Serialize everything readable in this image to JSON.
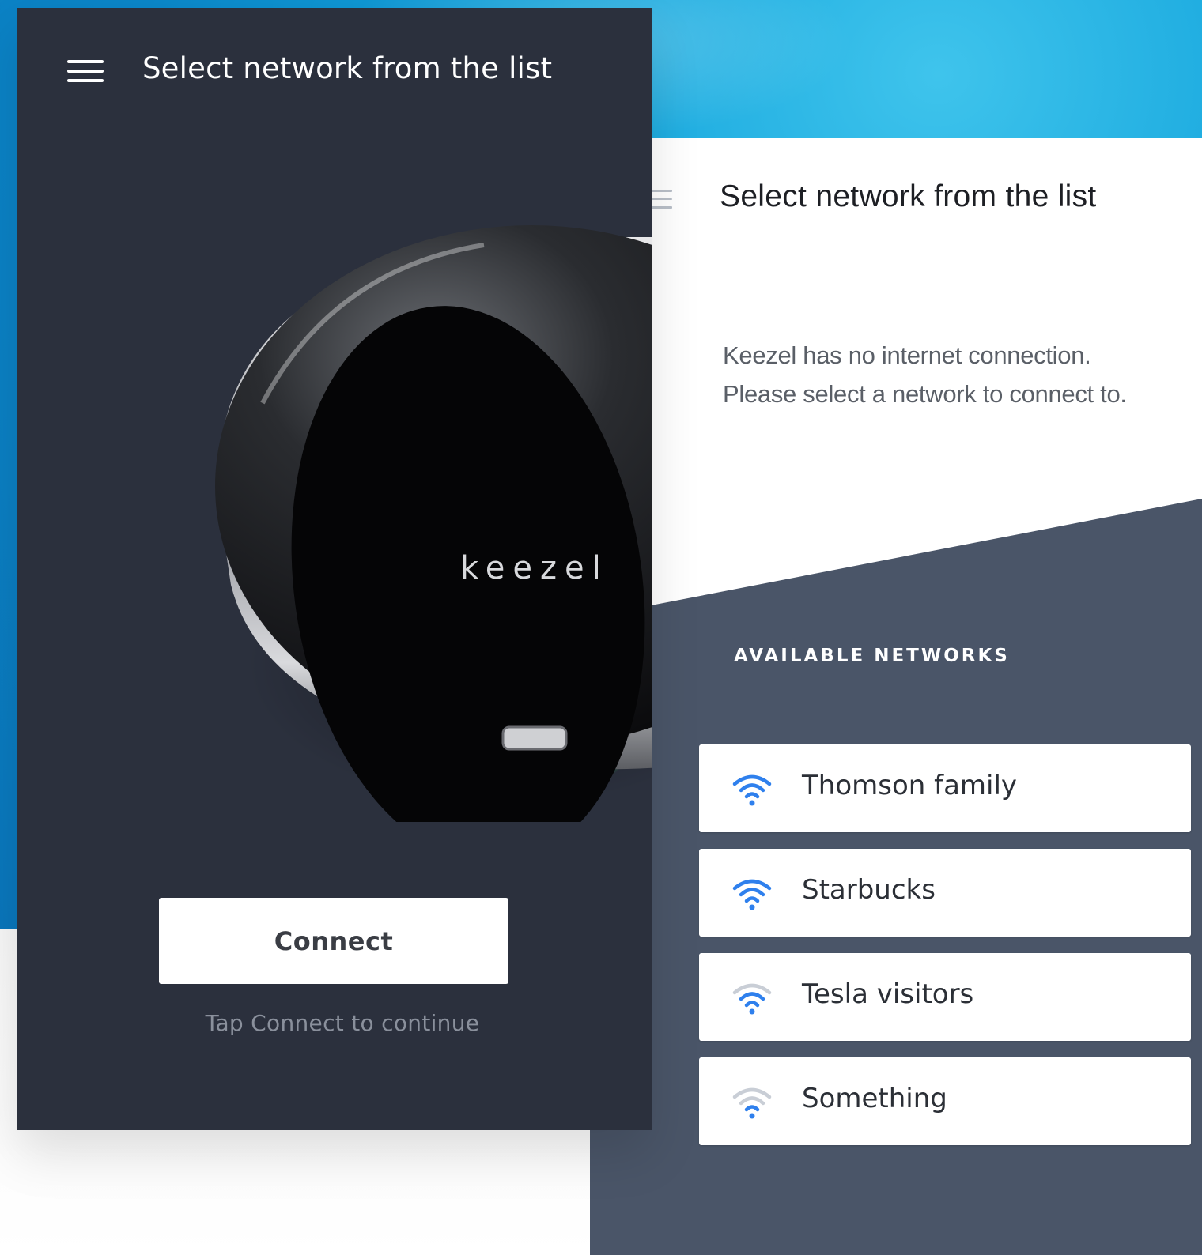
{
  "left_screen": {
    "title": "Select network from the list",
    "device_brand": "keezel",
    "connect_label": "Connect",
    "hint": "Tap Connect to continue"
  },
  "right_screen": {
    "title": "Select network from the list",
    "message_line1": "Keezel has no internet connection.",
    "message_line2": "Please select a network to connect to.",
    "section_label": "AVAILABLE NETWORKS",
    "networks": [
      {
        "name": "Thomson family",
        "signal": "strong"
      },
      {
        "name": "Starbucks",
        "signal": "strong"
      },
      {
        "name": "Tesla visitors",
        "signal": "medium"
      },
      {
        "name": "Something",
        "signal": "weak"
      }
    ]
  },
  "colors": {
    "left_bg": "#2b303d",
    "right_slate": "#4a5568",
    "wifi_active": "#2f80ed",
    "wifi_inactive": "#c9ced6",
    "device_led": "#3cf06a"
  }
}
